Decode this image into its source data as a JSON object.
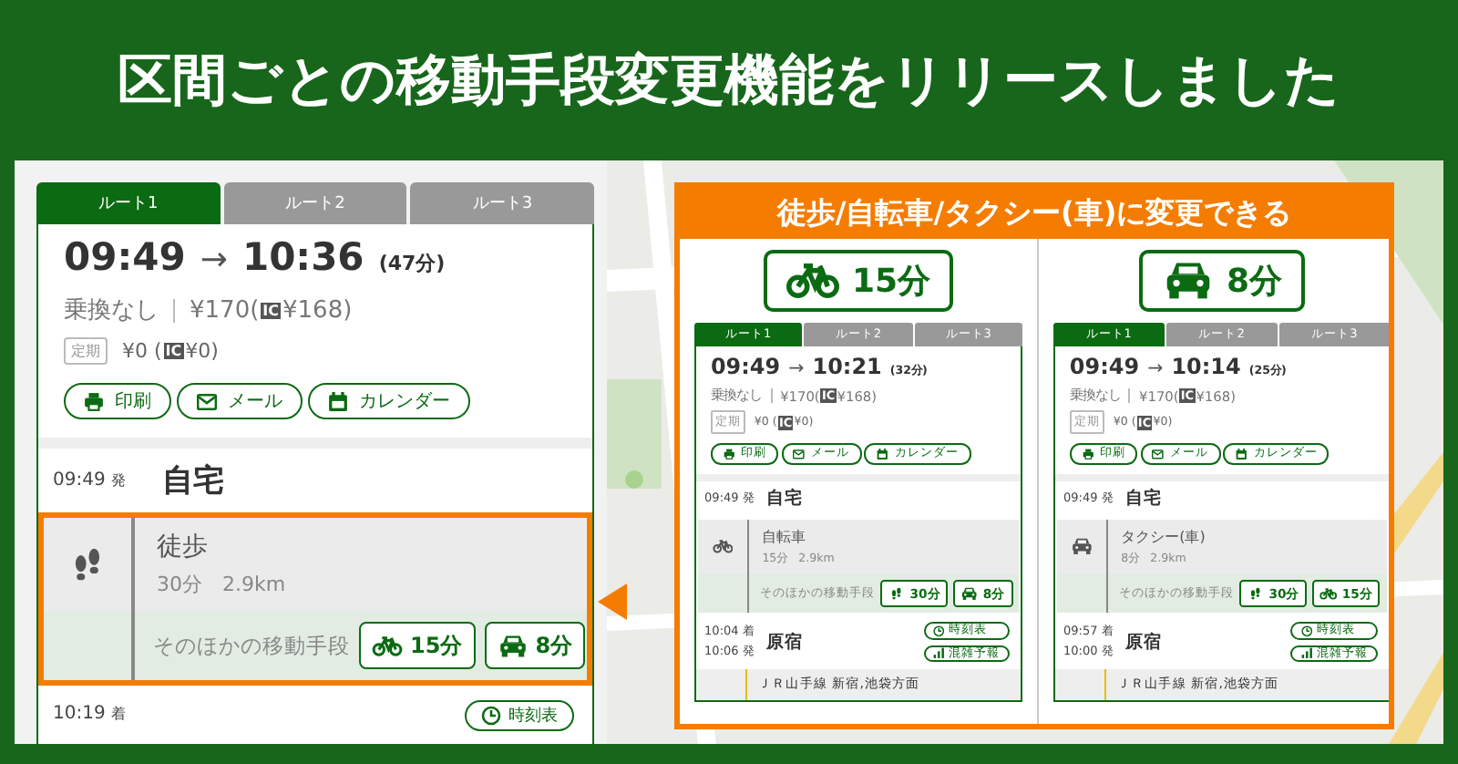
{
  "headline": "区間ごとの移動手段変更機能をリリースしました",
  "main_card": {
    "tabs": [
      {
        "label": "ルート1",
        "selected": true
      },
      {
        "label": "ルート2",
        "selected": false
      },
      {
        "label": "ルート3",
        "selected": false
      }
    ],
    "depart": "09:49",
    "arrow": "→",
    "arrive": "10:36",
    "duration": "(47分)",
    "transfers": "乗換なし",
    "fare": "¥170(",
    "ic": "IC",
    "fare_ic": "¥168)",
    "pass_tag": "定期",
    "pass_fare": "¥0 (",
    "pass_ic": "IC",
    "pass_fare_ic": "¥0)",
    "actions": [
      {
        "kind": "print",
        "label": "印刷"
      },
      {
        "kind": "mail",
        "label": "メール"
      },
      {
        "kind": "calendar",
        "label": "カレンダー"
      }
    ],
    "legs": [
      {
        "kind": "stop",
        "times": [
          {
            "time": "09:49",
            "suffix": "発"
          }
        ],
        "name": "自宅"
      },
      {
        "kind": "move",
        "mode": {
          "kind": "walk",
          "label": "徒歩"
        },
        "detail": "30分　2.9km",
        "highlighted": true,
        "alt_label": "そのほかの移動手段",
        "alternatives": [
          {
            "kind": "bicycle",
            "label": "15分"
          },
          {
            "kind": "car",
            "label": "8分"
          }
        ]
      },
      {
        "kind": "stop",
        "times": [
          {
            "time": "10:19",
            "suffix": "着"
          }
        ],
        "buttons": [
          {
            "kind": "timetable",
            "label": "時刻表"
          }
        ]
      }
    ]
  },
  "callout": {
    "title": "徒歩/自転車/タクシー(車)に変更できる",
    "columns": [
      {
        "badge": {
          "kind": "bicycle",
          "label": "15分"
        },
        "card": {
          "tabs": [
            {
              "label": "ルート1",
              "selected": true
            },
            {
              "label": "ルート2",
              "selected": false
            },
            {
              "label": "ルート3",
              "selected": false
            }
          ],
          "depart": "09:49",
          "arrow": "→",
          "arrive": "10:21",
          "duration": "(32分)",
          "transfers": "乗換なし",
          "fare": "¥170(",
          "ic": "IC",
          "fare_ic": "¥168)",
          "pass_tag": "定期",
          "pass_fare": "¥0 (",
          "pass_ic": "IC",
          "pass_fare_ic": "¥0)",
          "actions": [
            {
              "kind": "print",
              "label": "印刷"
            },
            {
              "kind": "mail",
              "label": "メール"
            },
            {
              "kind": "calendar",
              "label": "カレンダー"
            }
          ],
          "legs": [
            {
              "kind": "stop",
              "times": [
                {
                  "time": "09:49",
                  "suffix": "発"
                }
              ],
              "name": "自宅"
            },
            {
              "kind": "move",
              "mode": {
                "kind": "bicycle",
                "label": "自転車"
              },
              "detail": "15分　2.9km",
              "highlighted": false,
              "alt_label": "そのほかの移動手段",
              "alternatives": [
                {
                  "kind": "walk",
                  "label": "30分"
                },
                {
                  "kind": "car",
                  "label": "8分"
                }
              ]
            },
            {
              "kind": "stop",
              "times": [
                {
                  "time": "10:04",
                  "suffix": "着"
                },
                {
                  "time": "10:06",
                  "suffix": "発"
                }
              ],
              "name": "原宿",
              "buttons": [
                {
                  "kind": "timetable",
                  "label": "時刻表"
                },
                {
                  "kind": "crowd",
                  "label": "混雑予報"
                }
              ]
            },
            {
              "kind": "line",
              "label": "ＪＲ山手線 新宿,池袋方面"
            }
          ]
        }
      },
      {
        "badge": {
          "kind": "car",
          "label": "8分"
        },
        "card": {
          "tabs": [
            {
              "label": "ルート1",
              "selected": true
            },
            {
              "label": "ルート2",
              "selected": false
            },
            {
              "label": "ルート3",
              "selected": false
            }
          ],
          "depart": "09:49",
          "arrow": "→",
          "arrive": "10:14",
          "duration": "(25分)",
          "transfers": "乗換なし",
          "fare": "¥170(",
          "ic": "IC",
          "fare_ic": "¥168)",
          "pass_tag": "定期",
          "pass_fare": "¥0 (",
          "pass_ic": "IC",
          "pass_fare_ic": "¥0)",
          "actions": [
            {
              "kind": "print",
              "label": "印刷"
            },
            {
              "kind": "mail",
              "label": "メール"
            },
            {
              "kind": "calendar",
              "label": "カレンダー"
            }
          ],
          "legs": [
            {
              "kind": "stop",
              "times": [
                {
                  "time": "09:49",
                  "suffix": "発"
                }
              ],
              "name": "自宅"
            },
            {
              "kind": "move",
              "mode": {
                "kind": "car",
                "label": "タクシー(車)"
              },
              "detail": "8分　2.9km",
              "highlighted": false,
              "alt_label": "そのほかの移動手段",
              "alternatives": [
                {
                  "kind": "walk",
                  "label": "30分"
                },
                {
                  "kind": "bicycle",
                  "label": "15分"
                }
              ]
            },
            {
              "kind": "stop",
              "times": [
                {
                  "time": "09:57",
                  "suffix": "着"
                },
                {
                  "time": "10:00",
                  "suffix": "発"
                }
              ],
              "name": "原宿",
              "buttons": [
                {
                  "kind": "timetable",
                  "label": "時刻表"
                },
                {
                  "kind": "crowd",
                  "label": "混雑予報"
                }
              ]
            },
            {
              "kind": "line",
              "label": "ＪＲ山手線 新宿,池袋方面"
            }
          ]
        }
      }
    ]
  }
}
